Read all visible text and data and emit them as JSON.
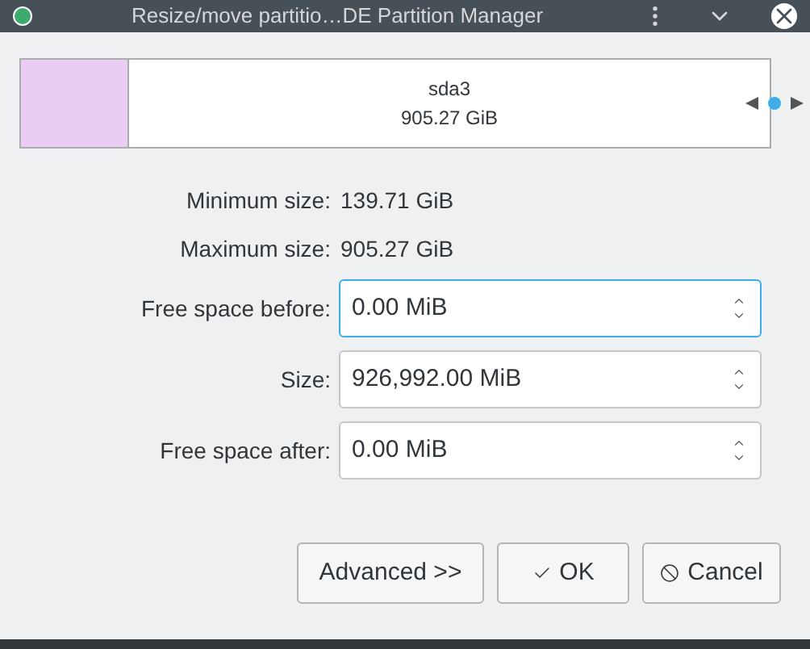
{
  "window": {
    "title": "Resize/move partitio…DE Partition Manager"
  },
  "partition": {
    "name": "sda3",
    "size": "905.27 GiB"
  },
  "info": [
    {
      "label": "Minimum size:",
      "value": "139.71 GiB"
    },
    {
      "label": "Maximum size:",
      "value": "905.27 GiB"
    }
  ],
  "fields": [
    {
      "label": "Free space before:",
      "value": "0.00 MiB",
      "focused": true
    },
    {
      "label": "Size:",
      "value": "926,992.00 MiB",
      "focused": false
    },
    {
      "label": "Free space after:",
      "value": "0.00 MiB",
      "focused": false
    }
  ],
  "buttons": [
    {
      "label": "Advanced >>",
      "kind": "plain"
    },
    {
      "label": "OK",
      "kind": "ok"
    },
    {
      "label": "Cancel",
      "kind": "cancel"
    }
  ]
}
